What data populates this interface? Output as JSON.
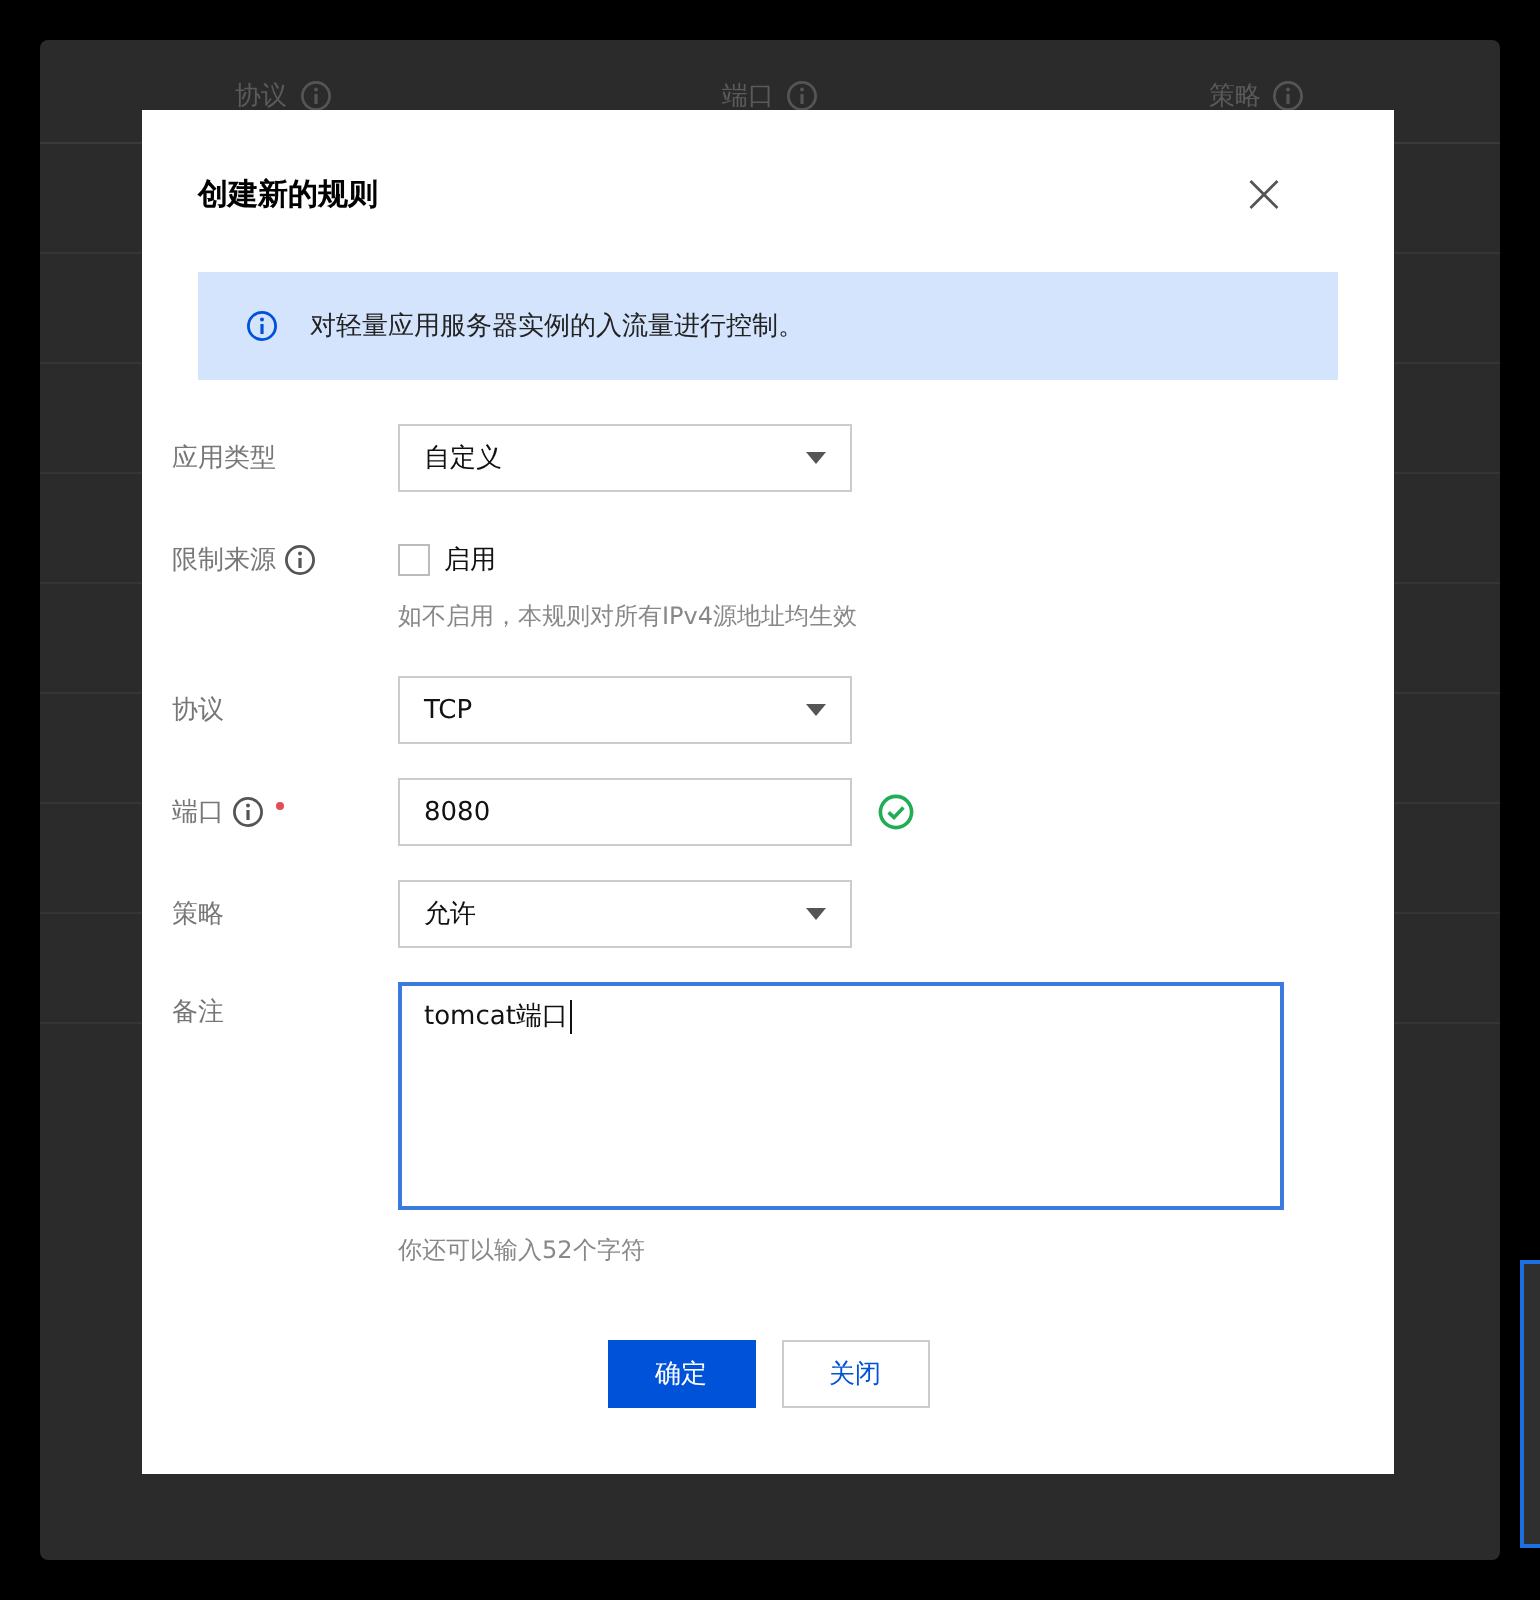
{
  "background": {
    "columns": [
      {
        "label": "协议",
        "info": true
      },
      {
        "label": "端口",
        "info": true
      },
      {
        "label": "策略",
        "info": true
      }
    ]
  },
  "dialog": {
    "title": "创建新的规则",
    "close": "×",
    "notice": "对轻量应用服务器实例的入流量进行控制。",
    "fields": [
      {
        "kind": "select",
        "label": "应用类型",
        "info": false,
        "required": false,
        "value": "自定义"
      },
      {
        "kind": "checkbox",
        "label": "限制来源",
        "info": true,
        "required": false,
        "option": "启用",
        "checked": false,
        "hint": "如不启用，本规则对所有IPv4源地址均生效"
      },
      {
        "kind": "select",
        "label": "协议",
        "info": false,
        "required": false,
        "value": "TCP"
      },
      {
        "kind": "input",
        "label": "端口",
        "info": true,
        "required": true,
        "value": "8080",
        "valid": true
      },
      {
        "kind": "select",
        "label": "策略",
        "info": false,
        "required": false,
        "value": "允许"
      },
      {
        "kind": "textarea",
        "label": "备注",
        "info": false,
        "required": false,
        "value": "tomcat端口",
        "focused": true,
        "hint": "你还可以输入52个字符"
      }
    ],
    "buttons": [
      {
        "kind": "primary",
        "label": "确定"
      },
      {
        "kind": "default",
        "label": "关闭"
      }
    ]
  }
}
